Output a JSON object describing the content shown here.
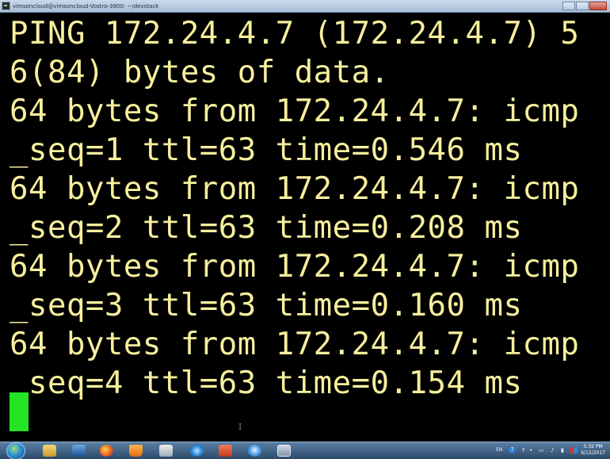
{
  "window": {
    "title": "vimsoncloud@vimsoncloud-Vostro-3800: ~/devstack"
  },
  "terminal": {
    "lines": [
      "PING 172.24.4.7 (172.24.4.7) 5",
      "6(84) bytes of data.",
      "64 bytes from 172.24.4.7: icmp",
      "_seq=1 ttl=63 time=0.546 ms",
      "64 bytes from 172.24.4.7: icmp",
      "_seq=2 ttl=63 time=0.208 ms",
      "64 bytes from 172.24.4.7: icmp",
      "_seq=3 ttl=63 time=0.160 ms",
      "64 bytes from 172.24.4.7: icmp",
      "_seq=4 ttl=63 time=0.154 ms"
    ],
    "text_color": "#f7ef9c",
    "background_color": "#000000",
    "cursor_color": "#25e325",
    "mouse_cursor_glyph": "I"
  },
  "taskbar": {
    "icons": [
      "folder-icon",
      "media-player-icon",
      "firefox-icon",
      "vlc-icon",
      "paint-icon",
      "internet-explorer-icon",
      "presentation-icon",
      "chat-icon",
      "terminal-icon"
    ],
    "tray": {
      "language": "EN",
      "help_glyph": "?",
      "time": "5:32 PM",
      "date": "6/12/2017"
    }
  }
}
